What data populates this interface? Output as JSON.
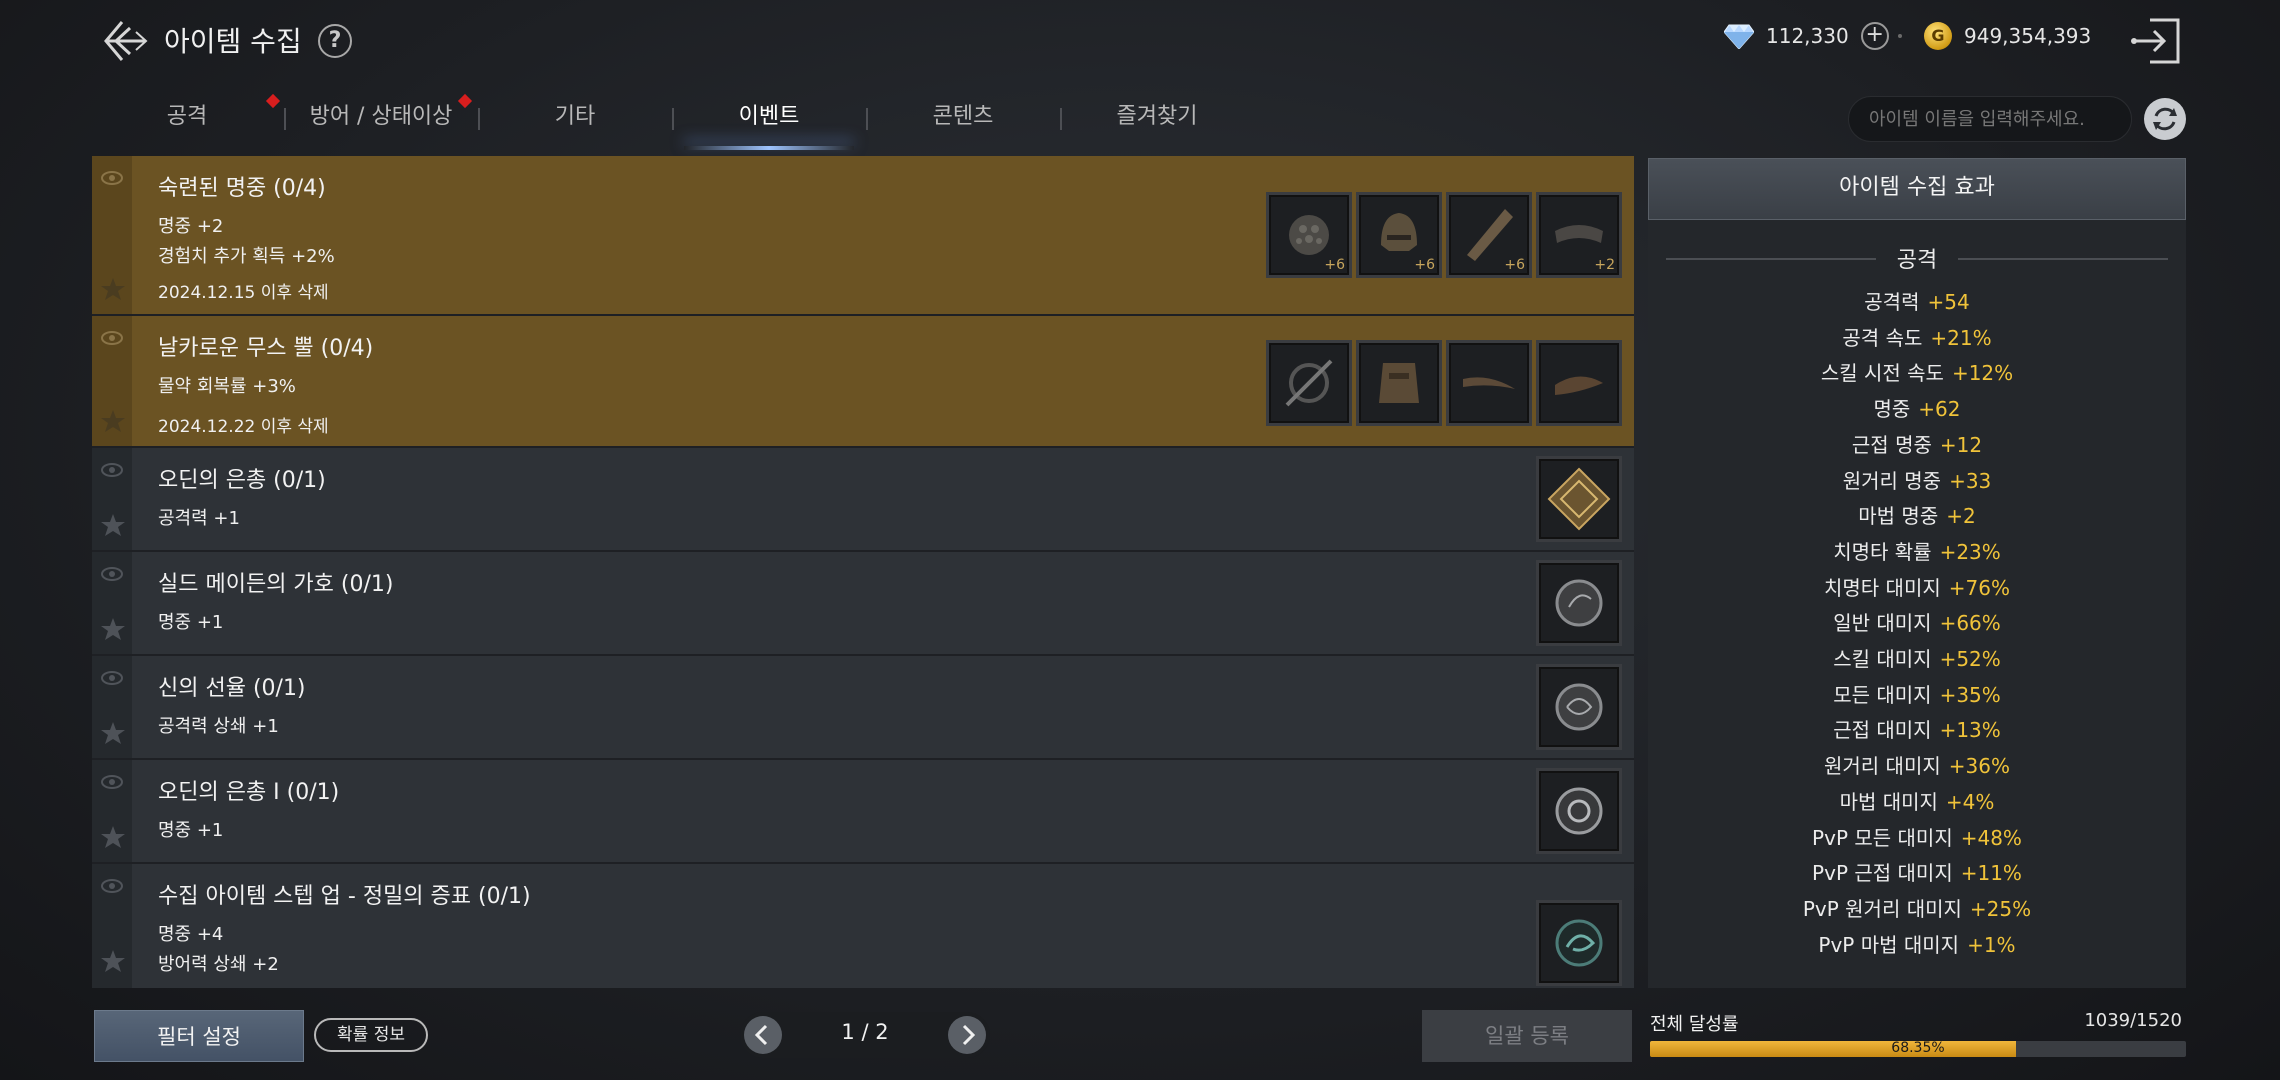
{
  "header": {
    "title": "아이템 수집",
    "help": "?",
    "diamonds": "112,330",
    "gold": "949,354,393",
    "gold_symbol": "G"
  },
  "tabs": [
    {
      "label": "공격",
      "alert": true
    },
    {
      "label": "방어 / 상태이상",
      "alert": true
    },
    {
      "label": "기타",
      "alert": false
    },
    {
      "label": "이벤트",
      "alert": false,
      "active": true
    },
    {
      "label": "콘텐츠",
      "alert": false
    },
    {
      "label": "즐겨찾기",
      "alert": false
    }
  ],
  "search": {
    "placeholder": "아이템 이름을 입력해주세요."
  },
  "collections": [
    {
      "title": "숙련된 명중 (0/4)",
      "stats": [
        "명중 +2",
        "경험치 추가 획득 +2%"
      ],
      "date": "2024.12.15 이후 삭제",
      "event": true,
      "items": [
        {
          "icon": "spiked-ball-icon",
          "level": "+6"
        },
        {
          "icon": "helmet-icon",
          "level": "+6"
        },
        {
          "icon": "horn-icon",
          "level": "+6"
        },
        {
          "icon": "bracer-icon",
          "level": "+2"
        }
      ]
    },
    {
      "title": "날카로운 무스 뿔 (0/4)",
      "stats": [
        "물약 회복률 +3%"
      ],
      "date": "2024.12.22 이후 삭제",
      "event": true,
      "items": [
        {
          "icon": "shield-sword-icon",
          "level": ""
        },
        {
          "icon": "armor-icon",
          "level": ""
        },
        {
          "icon": "blade-icon",
          "level": ""
        },
        {
          "icon": "ring-icon",
          "level": ""
        }
      ]
    },
    {
      "title": "오딘의 은총 (0/1)",
      "stats": [
        "공격력 +1"
      ],
      "date": "",
      "event": false,
      "items": [
        {
          "icon": "rune-card-icon",
          "level": ""
        }
      ]
    },
    {
      "title": "실드 메이든의 가호 (0/1)",
      "stats": [
        "명중 +1"
      ],
      "date": "",
      "event": false,
      "items": [
        {
          "icon": "coin-icon",
          "level": ""
        }
      ]
    },
    {
      "title": "신의 선율 (0/1)",
      "stats": [
        "공격력 상쇄 +1"
      ],
      "date": "",
      "event": false,
      "items": [
        {
          "icon": "coin-icon",
          "level": ""
        }
      ]
    },
    {
      "title": "오딘의 은총 I (0/1)",
      "stats": [
        "명중 +1"
      ],
      "date": "",
      "event": false,
      "items": [
        {
          "icon": "medal-icon",
          "level": ""
        }
      ]
    },
    {
      "title": "수집 아이템 스텝 업 - 정밀의 증표 (0/1)",
      "stats": [
        "명중 +4",
        "방어력 상쇄 +2"
      ],
      "date": "",
      "event": false,
      "items": [
        {
          "icon": "emblem-icon",
          "level": ""
        }
      ]
    }
  ],
  "panel": {
    "title": "아이템 수집 효과",
    "section": "공격",
    "stats": [
      {
        "name": "공격력",
        "value": "+54"
      },
      {
        "name": "공격 속도",
        "value": "+21%"
      },
      {
        "name": "스킬 시전 속도",
        "value": "+12%"
      },
      {
        "name": "명중",
        "value": "+62"
      },
      {
        "name": "근접 명중",
        "value": "+12"
      },
      {
        "name": "원거리 명중",
        "value": "+33"
      },
      {
        "name": "마법 명중",
        "value": "+2"
      },
      {
        "name": "치명타 확률",
        "value": "+23%"
      },
      {
        "name": "치명타 대미지",
        "value": "+76%"
      },
      {
        "name": "일반 대미지",
        "value": "+66%"
      },
      {
        "name": "스킬 대미지",
        "value": "+52%"
      },
      {
        "name": "모든 대미지",
        "value": "+35%"
      },
      {
        "name": "근접 대미지",
        "value": "+13%"
      },
      {
        "name": "원거리 대미지",
        "value": "+36%"
      },
      {
        "name": "마법 대미지",
        "value": "+4%"
      },
      {
        "name": "PvP 모든 대미지",
        "value": "+48%"
      },
      {
        "name": "PvP 근접 대미지",
        "value": "+11%"
      },
      {
        "name": "PvP 원거리 대미지",
        "value": "+25%"
      },
      {
        "name": "PvP 마법 대미지",
        "value": "+1%"
      }
    ]
  },
  "footer": {
    "filter": "필터 설정",
    "probability": "확률 정보",
    "page": "1 / 2",
    "bulk": "일괄 등록",
    "progress_label": "전체 달성률",
    "progress_count": "1039/1520",
    "progress_pct": "68.35%",
    "progress_fraction": 0.6835
  },
  "colors": {
    "event_row": "#6b5323",
    "normal_row": "#2e3237",
    "stat_value": "#f0c33a",
    "progress": "#e0a52a"
  }
}
